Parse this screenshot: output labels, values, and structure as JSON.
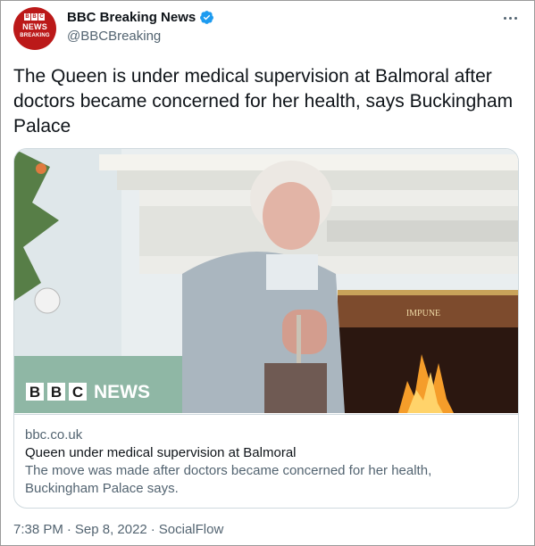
{
  "author": {
    "display_name": "BBC Breaking News",
    "handle": "@BBCBreaking",
    "verified": true,
    "avatar": {
      "logo_letters": [
        "B",
        "B",
        "C"
      ],
      "line1": "NEWS",
      "line2": "BREAKING",
      "color": "#bb1919"
    }
  },
  "tweet_text": "The Queen is under medical supervision at Balmoral after doctors became concerned for her health, says Buckingham Palace",
  "card": {
    "image_overlay": {
      "logo_letters": [
        "B",
        "B",
        "C"
      ],
      "word": "NEWS",
      "fireplace_inscription": "IMPUNE"
    },
    "domain": "bbc.co.uk",
    "title": "Queen under medical supervision at Balmoral",
    "description": "The move was made after doctors became concerned for her health, Buckingham Palace says."
  },
  "meta": {
    "time": "7:38 PM",
    "separator1": "·",
    "date": "Sep 8, 2022",
    "separator2": "·",
    "source": "SocialFlow"
  },
  "colors": {
    "accent_verified": "#1d9bf0",
    "text_primary": "#0f1419",
    "text_secondary": "#536471",
    "bbc_red": "#bb1919"
  },
  "icons": [
    "verified-badge-icon",
    "more-options-icon"
  ]
}
